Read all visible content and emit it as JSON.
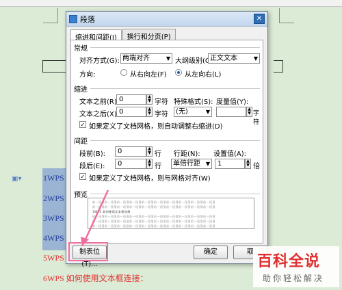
{
  "dialog": {
    "title": "段落",
    "close": "✕",
    "tabs": [
      "缩进和间距(I)",
      "换行和分页(P)"
    ],
    "general": {
      "heading": "常规",
      "align_label": "对齐方式(G):",
      "align_value": "两端对齐",
      "outline_label": "大纲级别(O):",
      "outline_value": "正文文本",
      "direction_label": "方向:",
      "rtl_label": "从右向左(F)",
      "ltr_label": "从左向右(L)",
      "direction_selected": "ltr"
    },
    "indent": {
      "heading": "缩进",
      "before_label": "文本之前(R):",
      "before_value": "0",
      "before_unit": "字符",
      "special_label": "特殊格式(S):",
      "special_value": "(无)",
      "measure_label": "度量值(Y):",
      "measure_value": "",
      "measure_unit": "字符",
      "after_label": "文本之后(X):",
      "after_value": "0",
      "after_unit": "字符",
      "grid_check": "如果定义了文档网格，则自动调整右缩进(D)",
      "grid_checked": true
    },
    "spacing": {
      "heading": "间距",
      "before_label": "段前(B):",
      "before_value": "0",
      "before_unit": "行",
      "line_label": "行距(N):",
      "line_value": "单倍行距",
      "setting_label": "设置值(A):",
      "setting_value": "1",
      "setting_unit": "倍",
      "after_label": "段后(E):",
      "after_value": "0",
      "after_unit": "行",
      "grid_check": "如果定义了文档网格，则与网格对齐(W)",
      "grid_checked": true
    },
    "preview": {
      "heading": "预览",
      "sample_line": "前一段落前一段落前一段落前一段落前一段落前一段落前一段落前一段落前一段落前一段落",
      "current_line": "1WPS 如何使用文本框连接"
    },
    "buttons": {
      "tabs": "制表位(T)...",
      "ok": "确定",
      "cancel": "取"
    }
  },
  "document": {
    "lines": [
      "1WPS",
      "2WPS",
      "3WPS",
      "4WPS"
    ],
    "red_line_5": "5WPS",
    "red_line_6": "6WPS 如何使用文本框连接："
  },
  "watermark": {
    "main": "百科全说",
    "sub": "助你轻松解决"
  },
  "colors": {
    "accent_blue": "#2c6fb7",
    "highlight": "#9bb4d4",
    "red_text": "#e03030",
    "pink_annotation": "#f06ea0"
  }
}
